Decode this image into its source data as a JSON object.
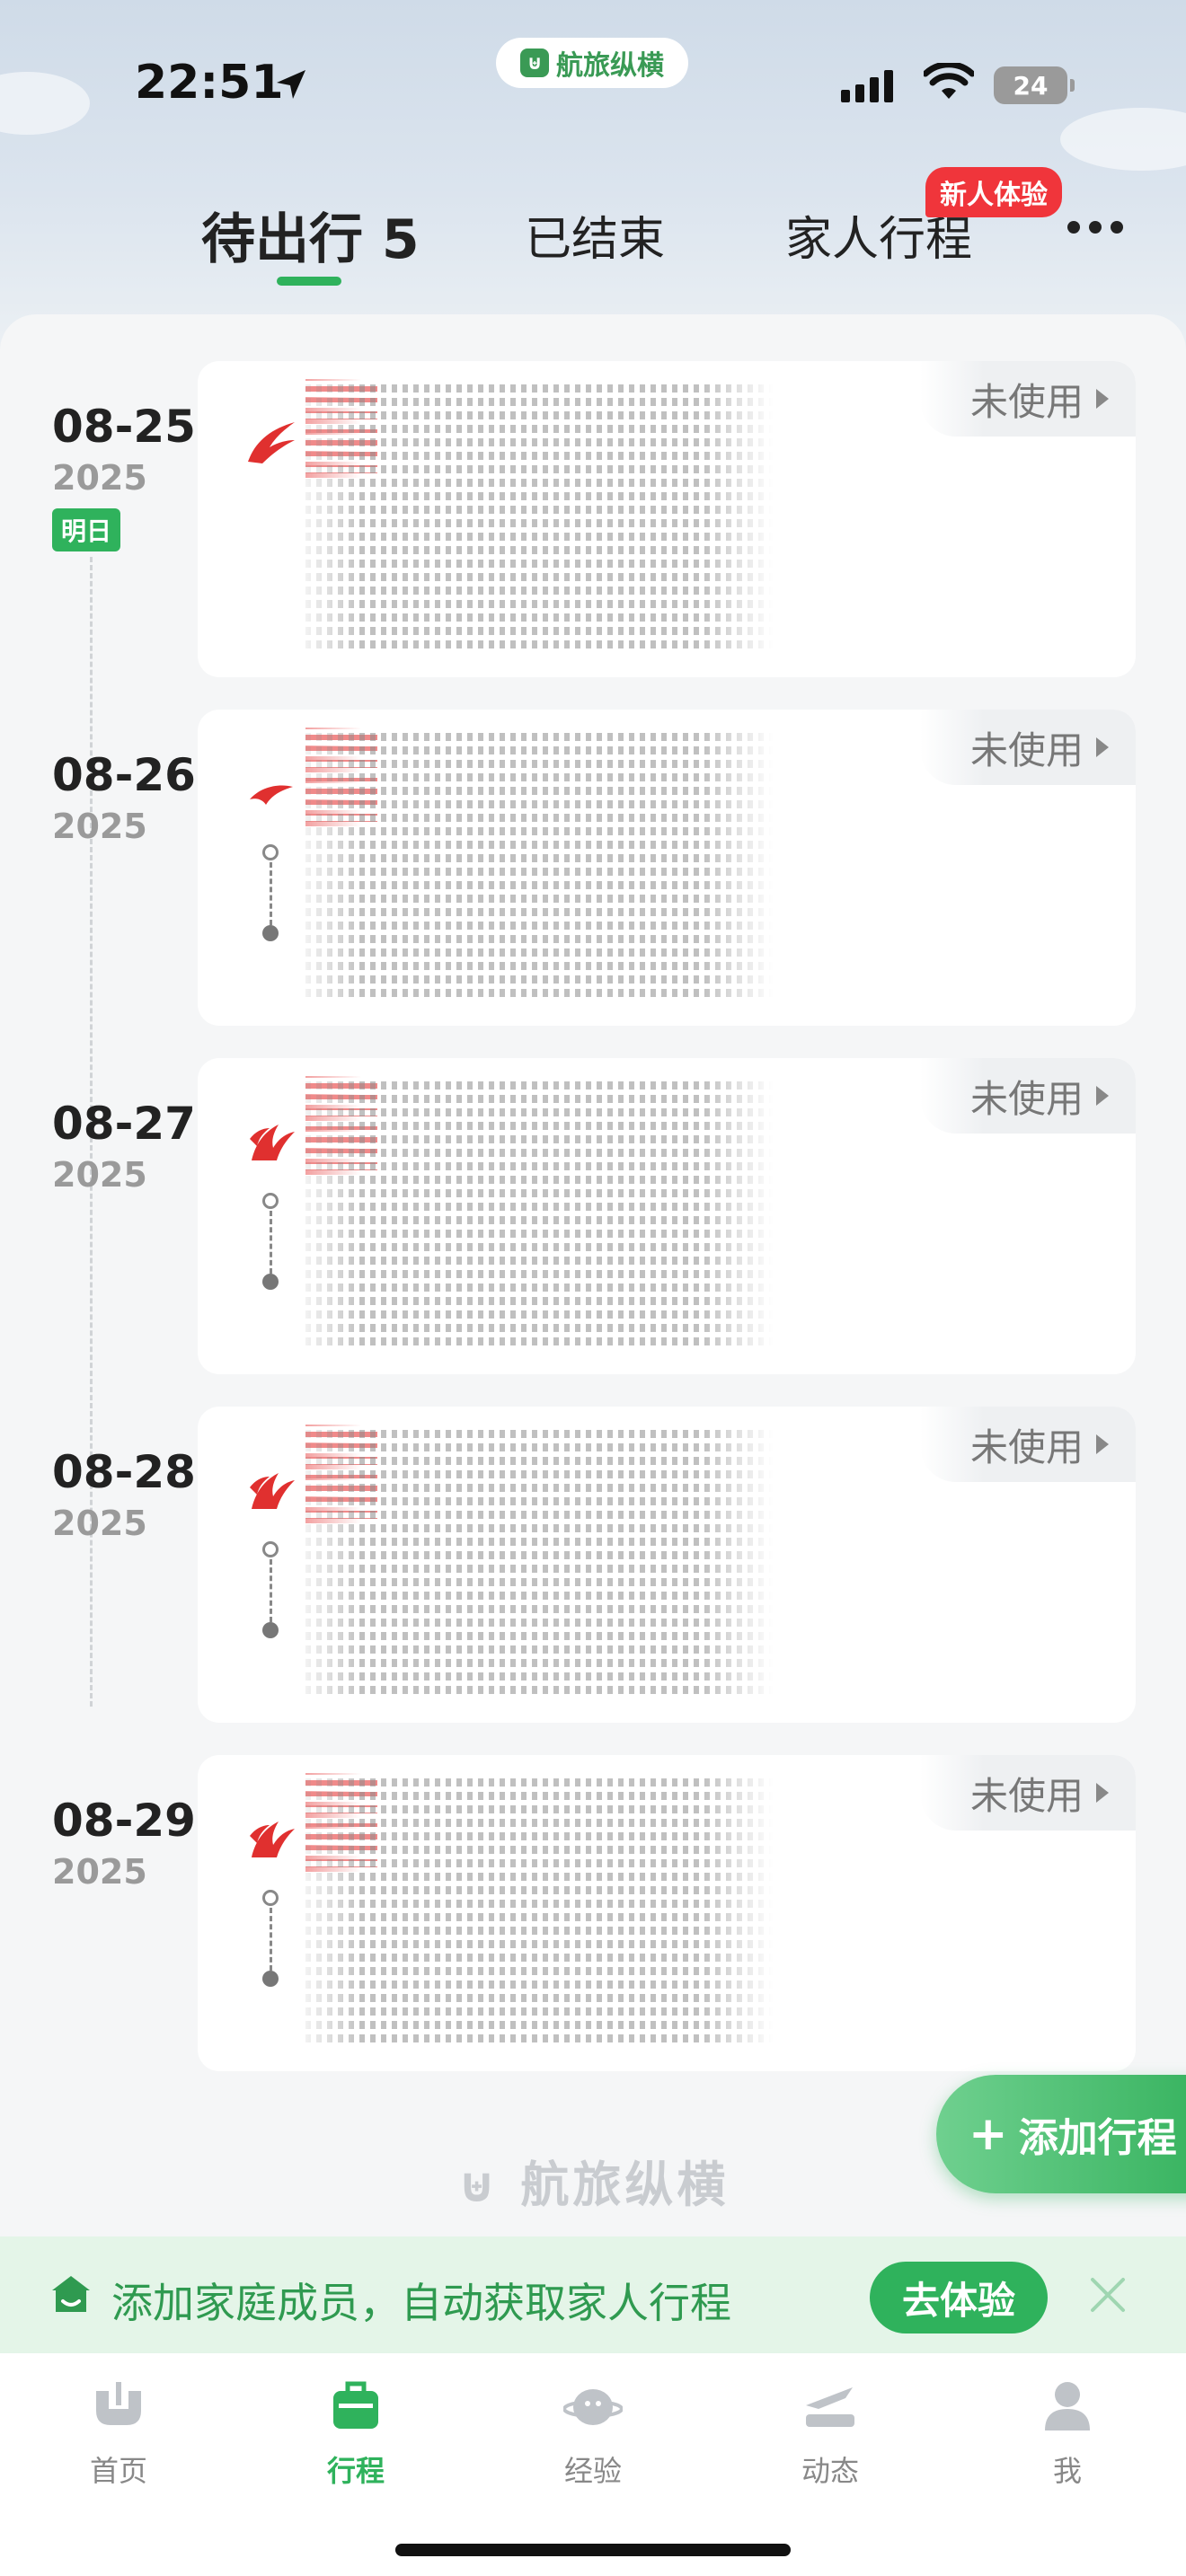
{
  "status_bar": {
    "time": "22:51",
    "app_name": "航旅纵横",
    "battery": "24"
  },
  "tabs": [
    {
      "label": "待出行 5",
      "active": true
    },
    {
      "label": "已结束",
      "active": false
    },
    {
      "label": "家人行程",
      "active": false,
      "badge": "新人体验"
    }
  ],
  "trips": [
    {
      "date": "08-25",
      "year": "2025",
      "tag": "明日",
      "status": "未使用"
    },
    {
      "date": "08-26",
      "year": "2025",
      "tag": "",
      "status": "未使用"
    },
    {
      "date": "08-27",
      "year": "2025",
      "tag": "",
      "status": "未使用"
    },
    {
      "date": "08-28",
      "year": "2025",
      "tag": "",
      "status": "未使用"
    },
    {
      "date": "08-29",
      "year": "2025",
      "tag": "",
      "status": "未使用"
    }
  ],
  "add_trip_label": "添加行程",
  "watermark": "航旅纵横",
  "family_banner": {
    "text": "添加家庭成员，自动获取家人行程",
    "button": "去体验"
  },
  "bottom_nav": [
    {
      "label": "首页",
      "icon": "home-logo-icon",
      "active": false
    },
    {
      "label": "行程",
      "icon": "suitcase-icon",
      "active": true
    },
    {
      "label": "经验",
      "icon": "planet-icon",
      "active": false
    },
    {
      "label": "动态",
      "icon": "flight-status-icon",
      "active": false
    },
    {
      "label": "我",
      "icon": "user-icon",
      "active": false
    }
  ],
  "colors": {
    "accent": "#2fb25c",
    "badge": "#f0353b",
    "airline_red": "#e0302f"
  }
}
